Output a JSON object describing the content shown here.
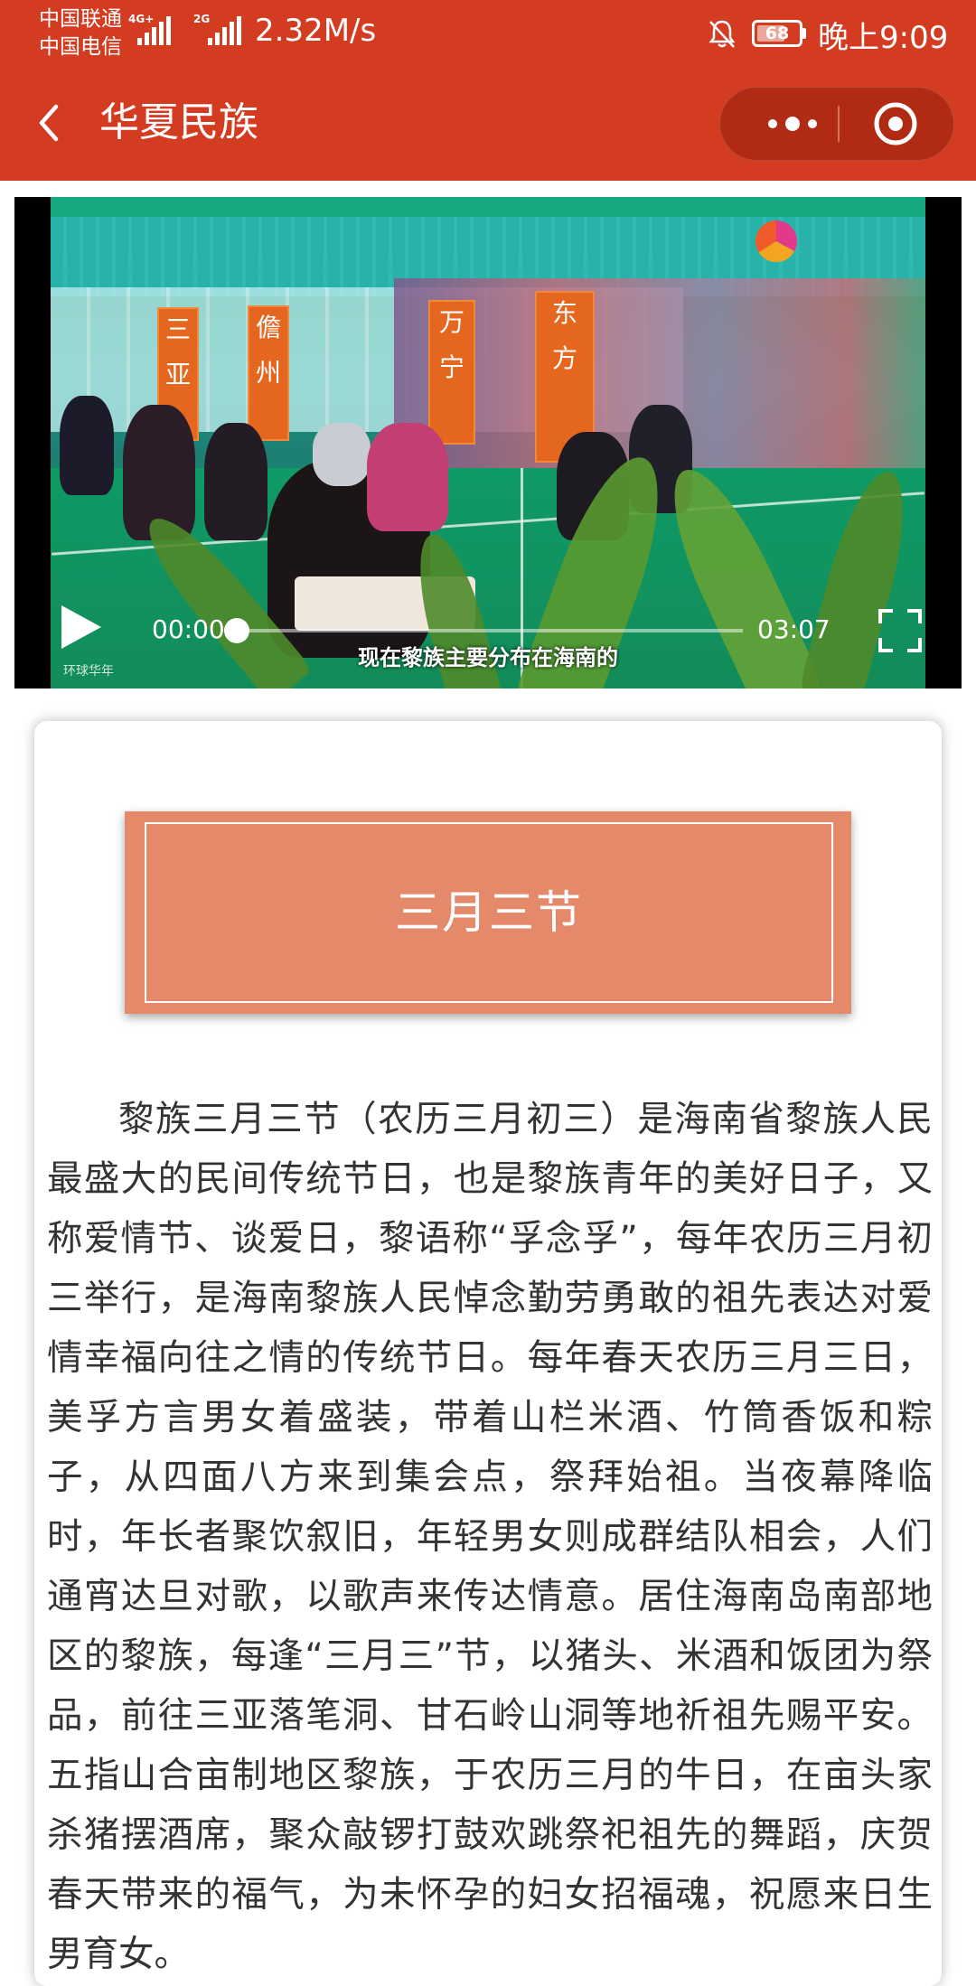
{
  "status_bar": {
    "carrier1": "中国联通",
    "carrier2": "中国电信",
    "net1": "4G+",
    "net2": "2G",
    "speed": "2.32M/s",
    "battery": "68",
    "time": "晚上9:09"
  },
  "nav": {
    "title": "华夏民族"
  },
  "video": {
    "current_time": "00:00",
    "total_time": "03:07",
    "progress": 0,
    "subtitle": "现在黎族主要分布在海南的",
    "watermark": "环球华年",
    "banners": [
      "三亚",
      "儋州",
      "万宁",
      "东方"
    ]
  },
  "article": {
    "title": "三月三节",
    "body": "黎族三月三节（农历三月初三）是海南省黎族人民最盛大的民间传统节日，也是黎族青年的美好日子，又称爱情节、谈爱日，黎语称“孚念孚”，每年农历三月初三举行，是海南黎族人民悼念勤劳勇敢的祖先表达对爱情幸福向往之情的传统节日。每年春天农历三月三日，美孚方言男女着盛装，带着山栏米酒、竹筒香饭和粽子，从四面八方来到集会点，祭拜始祖。当夜幕降临时，年长者聚饮叙旧，年轻男女则成群结队相会，人们通宵达旦对歌，以歌声来传达情意。居住海南岛南部地区的黎族，每逢“三月三”节，以猪头、米酒和饭团为祭品，前往三亚落笔洞、甘石岭山洞等地祈祖先赐平安。五指山合亩制地区黎族，于农历三月的牛日，在亩头家杀猪摆酒席，聚众敲锣打鼓欢跳祭祀祖先的舞蹈，庆贺春天带来的福气，为未怀孕的妇女招福魂，祝愿来日生男育女。"
  },
  "colors": {
    "header_red": "#d43c22",
    "capsule_red": "#b12a14",
    "title_box": "#e5896b"
  },
  "icons": [
    "back-arrow-icon",
    "more-dots-icon",
    "target-icon",
    "bell-off-icon",
    "play-icon",
    "fullscreen-icon"
  ]
}
